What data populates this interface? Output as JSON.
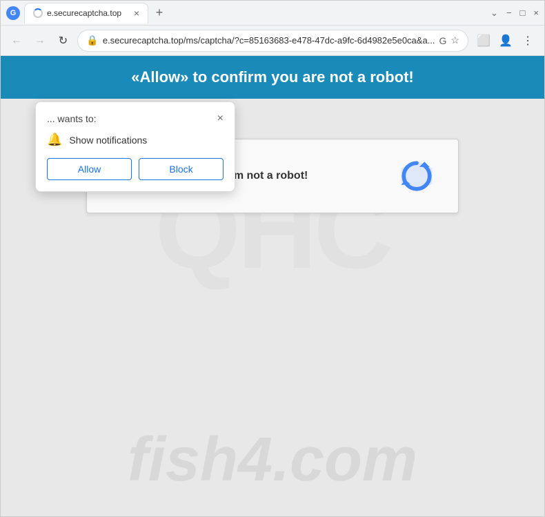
{
  "browser": {
    "title": "e.securecaptcha.top",
    "url": "e.securecaptcha.top/ms/captcha/?c=85163683-e478-47dc-a9fc-6d4982e5e0ca&a...",
    "tab_label": "e.securecaptcha.top",
    "nav": {
      "back": "←",
      "forward": "→",
      "refresh": "↻"
    },
    "window_controls": {
      "minimize": "−",
      "maximize": "□",
      "close": "×"
    }
  },
  "notification_popup": {
    "title": "... wants to:",
    "close_label": "×",
    "notification_text": "Show notifications",
    "allow_label": "Allow",
    "block_label": "Block"
  },
  "banner": {
    "text": "«Allow» to confirm you are not a robot!"
  },
  "captcha": {
    "label": "I'm not a robot!"
  },
  "watermark": {
    "text": "fish4.com",
    "bg_text": "QHC"
  }
}
